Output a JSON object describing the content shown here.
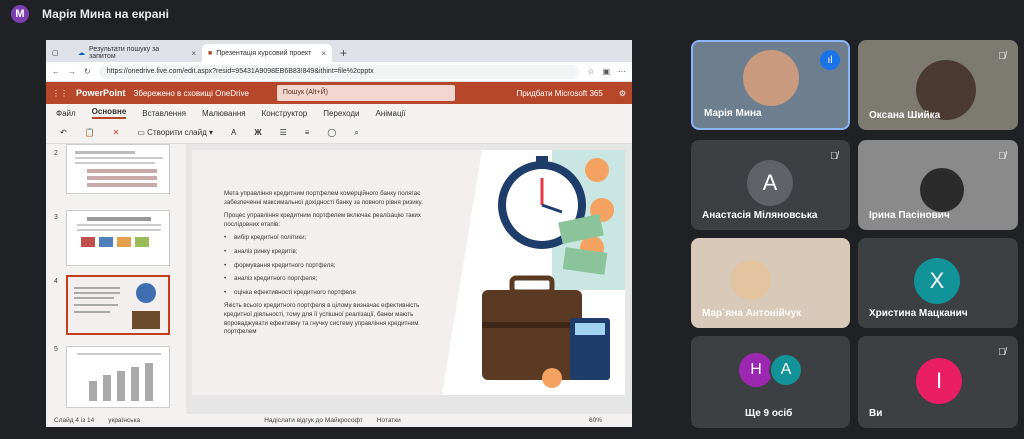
{
  "header": {
    "avatar_letter": "M",
    "title": "Марія Мина на екрані"
  },
  "browser": {
    "tab1": "Результати пошуку за запитом",
    "tab2": "Презентація курсовий проект",
    "url": "https://onedrive.live.com/edit.aspx?resid=95431A9098EB6B83!849&ithint=file%2cpptx"
  },
  "ppt": {
    "brand": "PowerPoint",
    "saved": "Збережено в сховищі OneDrive",
    "search_placeholder": "Пошук (Alt+Й)",
    "buy": "Придбати Microsoft 365",
    "ribbon_tabs": [
      "Файл",
      "Основне",
      "Вставлення",
      "Малювання",
      "Конструктор",
      "Переходи",
      "Анімації"
    ],
    "new_slide": "Створити слайд",
    "slide_numbers": [
      "2",
      "3",
      "4",
      "5"
    ],
    "status": {
      "slide": "Слайд 4 із 14",
      "lang": "українська",
      "feedback": "Надіслати відгук до Майкрософт",
      "notes": "Нотатки",
      "zoom": "60%"
    }
  },
  "slide": {
    "intro": "Мета управління кредитним портфелем комерційного банку полягає забезпеченні максимальної дохідності банку за повного рівня ризику.",
    "process": "Процес управління кредитним портфелем включає реалізацію таких послідовних етапів:",
    "steps": [
      "вибір кредитної політики;",
      "аналіз ринку кредитів;",
      "формування кредитного портфеля;",
      "аналіз кредитного портфеля;",
      "оцінка ефективності кредитного портфеля"
    ],
    "conclusion": "Якість всього кредитного портфеля в цілому визначає ефективність кредитної діяльності, тому для її успішної реалізації, банки мають впроваджувати ефективну та гнучку систему управління кредитним портфелем"
  },
  "participants": {
    "p1": "Марія Мина",
    "p2": "Оксана Шийка",
    "p3": {
      "letter": "А",
      "name": "Анастасія Міляновська"
    },
    "p4": "Ірина Пасінович",
    "p5": "Мар`яна Антонійчук",
    "p6": {
      "letter": "Х",
      "name": "Христина Мацканич"
    },
    "p7": {
      "letters": [
        "Н",
        "А"
      ],
      "name": "Ще 9 осіб"
    },
    "p8": {
      "letter": "І",
      "name": "Ви"
    }
  },
  "colors": {
    "accent": "#1a73e8",
    "ppt": "#b7472a",
    "bg": "#202124",
    "tile": "#3c4043"
  }
}
